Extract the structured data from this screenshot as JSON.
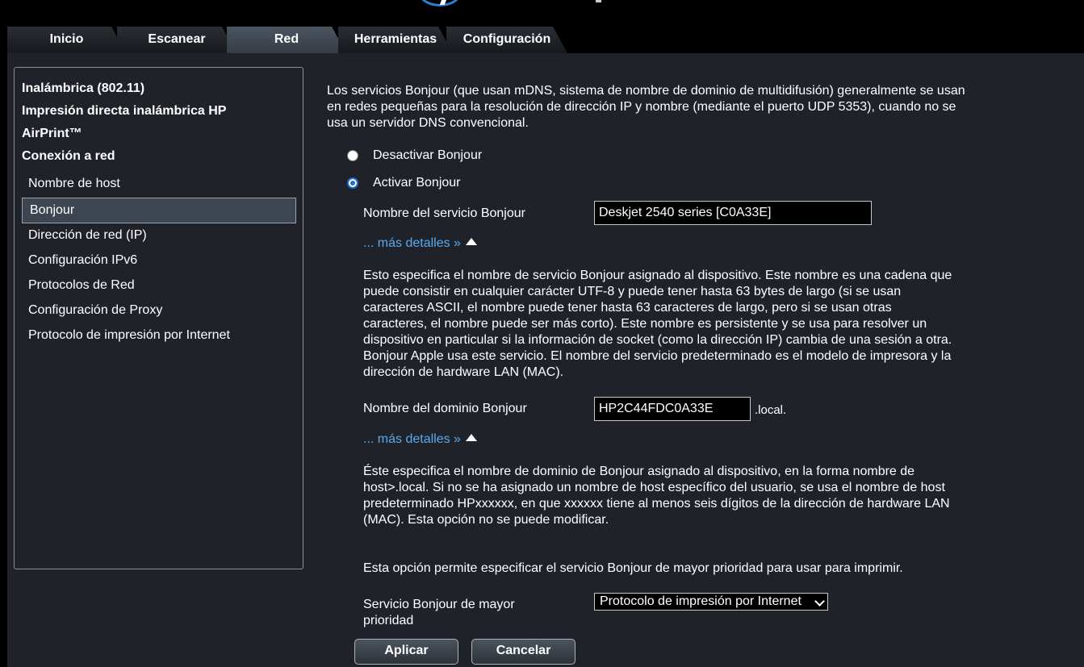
{
  "tabs": [
    "Inicio",
    "Escanear",
    "Red",
    "Herramientas",
    "Configuración"
  ],
  "sidebar": {
    "sections": [
      "Inalámbrica (802.11)",
      "Impresión directa inalámbrica HP",
      "AirPrint™",
      "Conexión a red"
    ],
    "items": [
      "Nombre de host",
      "Bonjour",
      "Dirección de red (IP)",
      "Configuración IPv6",
      "Protocolos de Red",
      "Configuración de Proxy",
      "Protocolo de impresión por Internet"
    ]
  },
  "main": {
    "intro": "Los servicios Bonjour (que usan mDNS, sistema de nombre de dominio de multidifusión) generalmente se usan en redes pequeñas para la resolución de dirección IP y nombre (mediante el puerto UDP 5353), cuando no se usa un servidor DNS convencional.",
    "radio_disable": "Desactivar Bonjour",
    "radio_enable": "Activar Bonjour",
    "service_name_label": "Nombre del servicio Bonjour",
    "service_name_value": "Deskjet 2540 series [C0A33E]",
    "more_details": "... más detalles »",
    "service_desc": "Esto especifica el nombre de servicio Bonjour asignado al dispositivo. Este nombre es una cadena que puede consistir en cualquier carácter UTF-8 y puede tener hasta 63 bytes de largo (si se usan caracteres ASCII, el nombre puede tener hasta 63 caracteres de largo, pero si se usan otras caracteres, el nombre puede ser más corto). Este nombre es persistente y se usa para resolver un dispositivo en particular si la información de socket (como la dirección IP) cambia de una sesión a otra. Bonjour Apple usa este servicio. El nombre del servicio predeterminado es el modelo de impresora y la dirección de hardware LAN (MAC).",
    "domain_label": "Nombre del dominio Bonjour",
    "domain_value": "HP2C44FDC0A33E",
    "domain_suffix": ".local.",
    "domain_desc": "Éste especifica el nombre de dominio de Bonjour asignado al dispositivo, en la forma nombre de host>.local. Si no se ha asignado un nombre de host específico del usuario, se usa el nombre de host predeterminado HPxxxxxx, en que xxxxxx tiene al menos seis dígitos de la dirección de hardware LAN (MAC). Esta opción no se puede modificar.",
    "priority_desc": "Esta opción permite especificar el servicio Bonjour de mayor prioridad para usar para imprimir.",
    "priority_label": "Servicio Bonjour de mayor prioridad",
    "priority_value": "Protocolo de impresión por Internet",
    "apply": "Aplicar",
    "cancel": "Cancelar"
  },
  "colors": {
    "link": "#5aa9ef",
    "radio_selected": "#1f6fd0",
    "panel": "#1f2329"
  },
  "icons": [
    "hp-logo-icon",
    "radio-icon",
    "triangle-up-icon",
    "chevron-down-icon"
  ]
}
